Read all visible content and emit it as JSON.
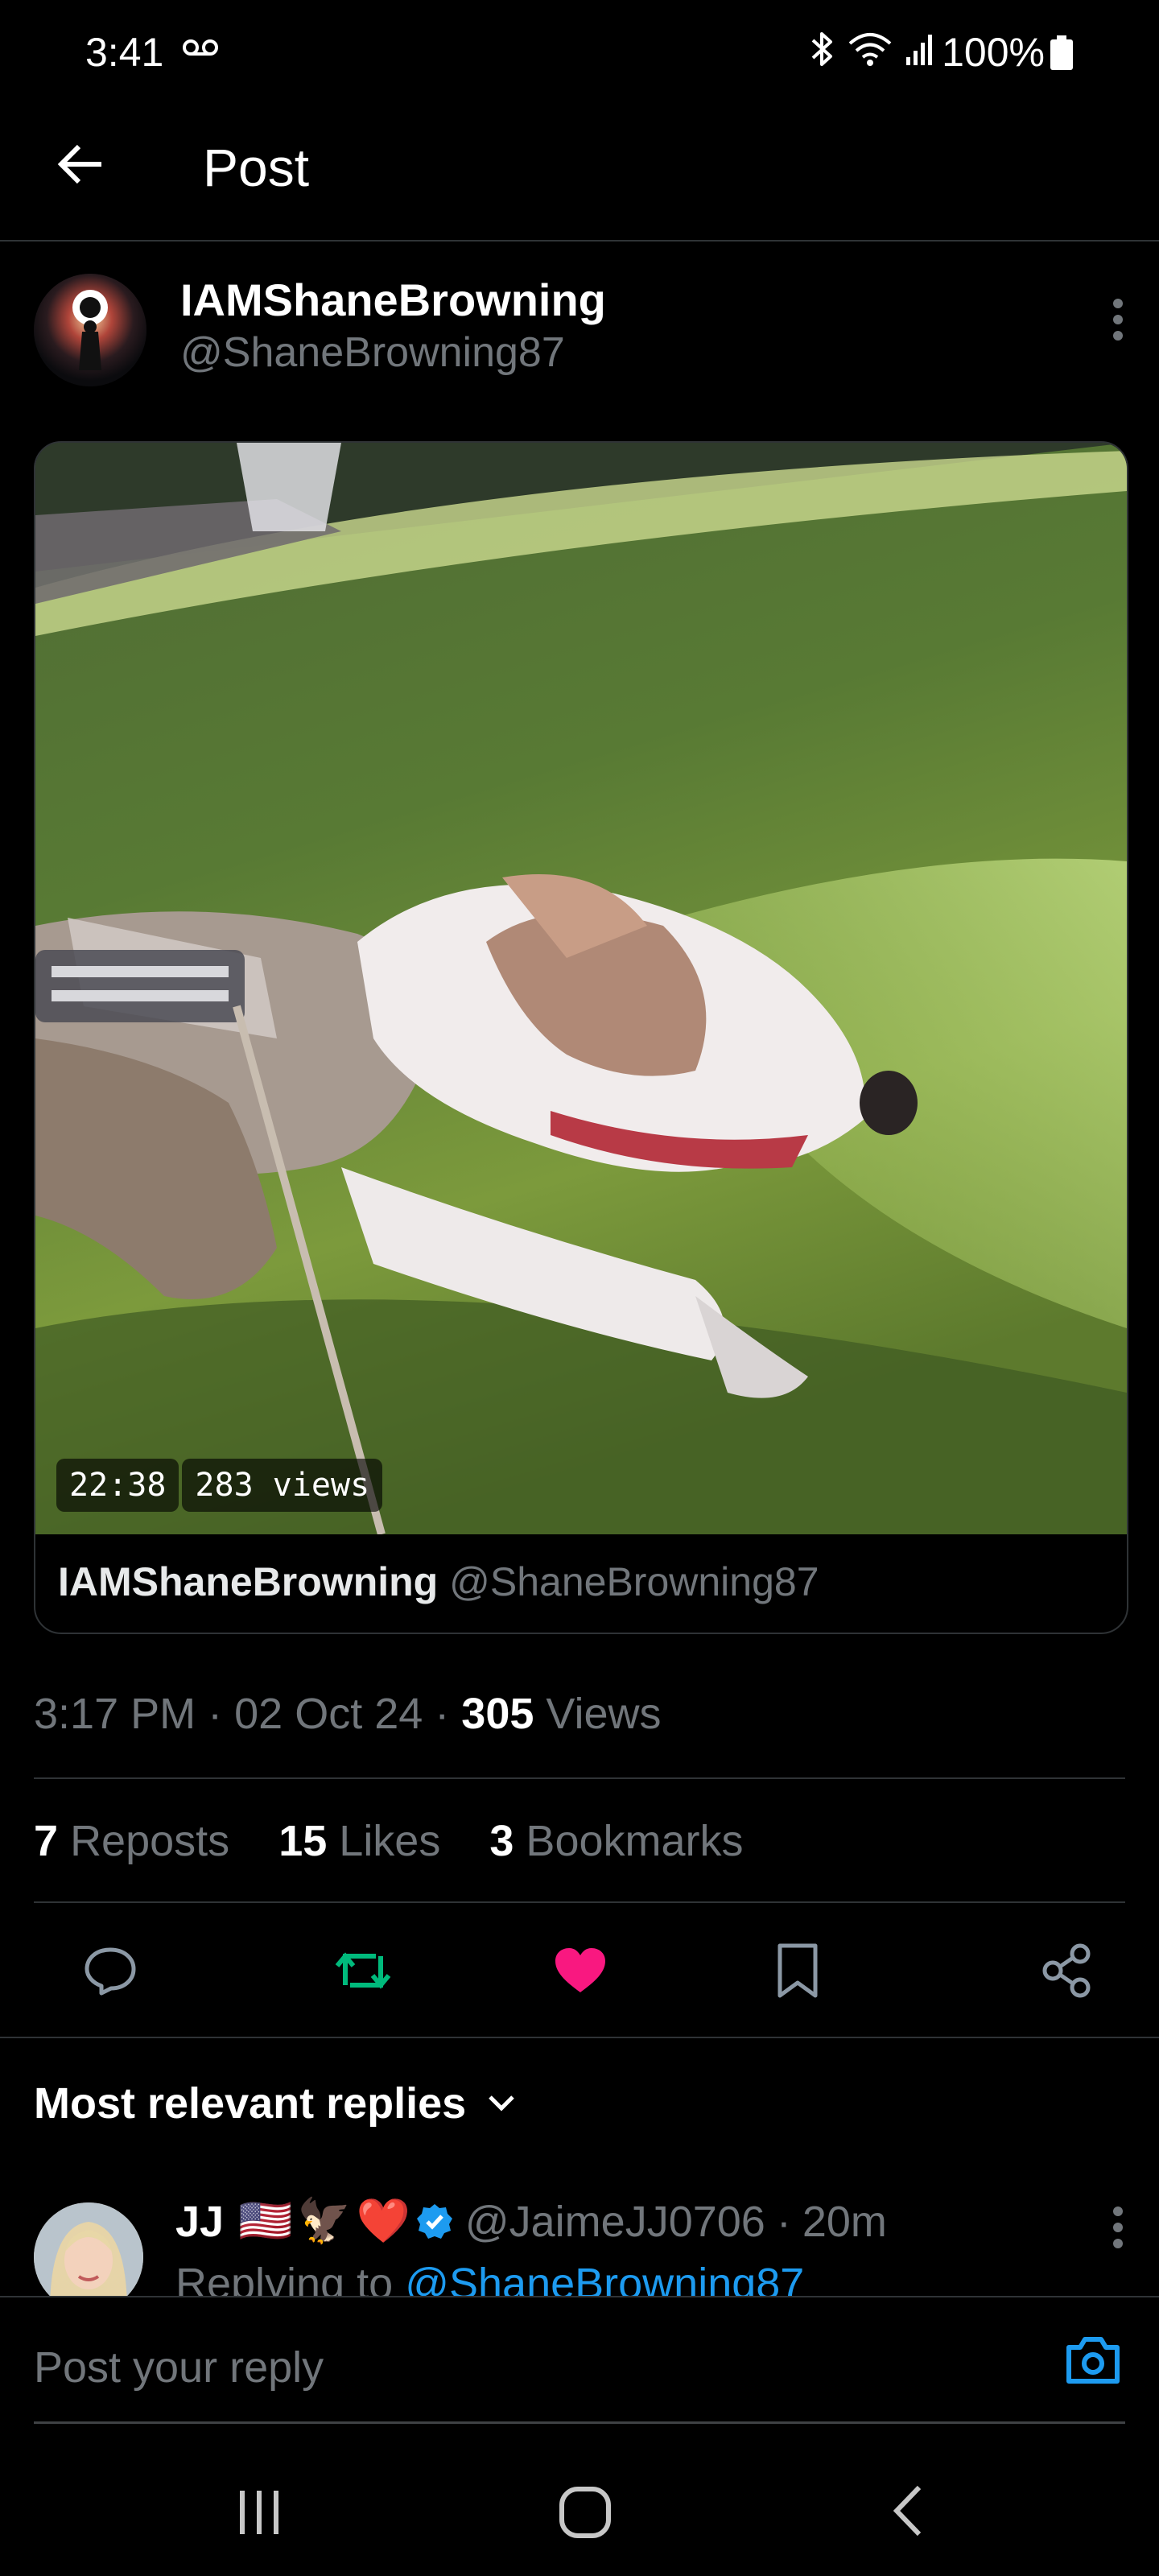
{
  "status_bar": {
    "time": "3:41",
    "battery_percent": "100%",
    "icons": [
      "voicemail-icon",
      "bluetooth-icon",
      "wifi-icon",
      "signal-icon",
      "battery-icon"
    ]
  },
  "header": {
    "title": "Post",
    "back_icon": "arrow-left-icon"
  },
  "post": {
    "author_name": "IAMShaneBrowning",
    "author_handle": "@ShaneBrowning87",
    "video_duration": "22:38",
    "video_views": "283 views",
    "card_author_name": "IAMShaneBrowning",
    "card_author_handle": "@ShaneBrowning87",
    "time": "3:17 PM",
    "date": "02 Oct 24",
    "views_count": "305",
    "views_label": "Views",
    "separator": "·",
    "reposts_count": "7",
    "reposts_label": "Reposts",
    "likes_count": "15",
    "likes_label": "Likes",
    "bookmarks_count": "3",
    "bookmarks_label": "Bookmarks"
  },
  "actions": {
    "reply_icon": "comment-icon",
    "repost_icon": "repost-icon",
    "like_icon": "heart-icon",
    "bookmark_icon": "bookmark-icon",
    "share_icon": "share-icon",
    "repost_color": "#00ba7c",
    "like_color": "#f91880"
  },
  "replies": {
    "heading": "Most relevant replies",
    "first_reply": {
      "name": "JJ",
      "emoji": [
        "🇺🇸",
        "🦅",
        "❤️"
      ],
      "handle": "@JaimeJJ0706",
      "time": "20m",
      "replying_prefix": "Replying to",
      "replying_handle": "@ShaneBrowning87"
    }
  },
  "composer": {
    "placeholder": "Post your reply",
    "camera_icon": "camera-icon",
    "accent_color": "#1d9bf0"
  },
  "nav_bar": {
    "icons": [
      "recents-icon",
      "home-icon",
      "back-icon"
    ]
  }
}
